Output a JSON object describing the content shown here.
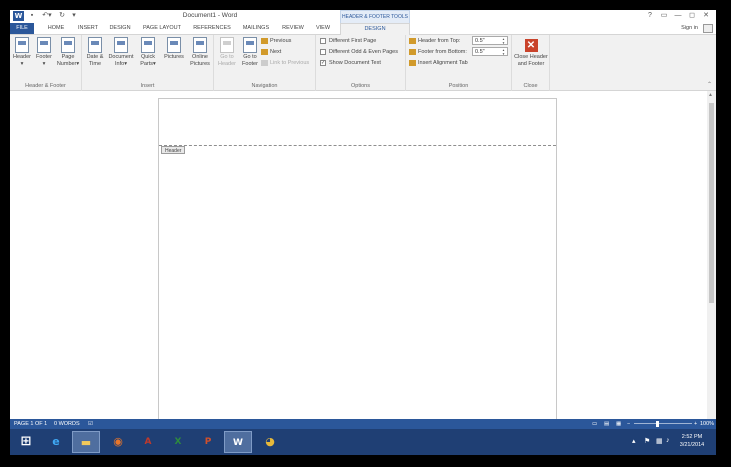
{
  "window": {
    "title": "Document1 - Word",
    "tools_header": "HEADER & FOOTER TOOLS",
    "controls": [
      "?",
      "▭",
      "—",
      "◻",
      "✕"
    ]
  },
  "tabs": {
    "file": "FILE",
    "items": [
      "HOME",
      "INSERT",
      "DESIGN",
      "PAGE LAYOUT",
      "REFERENCES",
      "MAILINGS",
      "REVIEW",
      "VIEW"
    ],
    "active": "DESIGN",
    "sign_in": "Sign in"
  },
  "ribbon": {
    "header_footer": {
      "label": "Header & Footer",
      "header": "Header",
      "footer": "Footer",
      "page_number_1": "Page",
      "page_number_2": "Number"
    },
    "insert": {
      "label": "Insert",
      "date_time_1": "Date &",
      "date_time_2": "Time",
      "doc_info_1": "Document",
      "doc_info_2": "Info",
      "quick_parts_1": "Quick",
      "quick_parts_2": "Parts",
      "pictures": "Pictures",
      "online_pictures_1": "Online",
      "online_pictures_2": "Pictures"
    },
    "navigation": {
      "label": "Navigation",
      "go_to_header_1": "Go to",
      "go_to_header_2": "Header",
      "go_to_footer_1": "Go to",
      "go_to_footer_2": "Footer",
      "previous": "Previous",
      "next": "Next",
      "link_to_previous": "Link to Previous"
    },
    "options": {
      "label": "Options",
      "different_first_page": "Different First Page",
      "different_odd_even": "Different Odd & Even Pages",
      "show_document_text": "Show Document Text",
      "show_document_text_checked": true
    },
    "position": {
      "label": "Position",
      "header_from_top": "Header from Top:",
      "header_from_top_value": "0.5\"",
      "footer_from_bottom": "Footer from Bottom:",
      "footer_from_bottom_value": "0.5\"",
      "insert_alignment_tab": "Insert Alignment Tab"
    },
    "close": {
      "label": "Close",
      "close_hf_1": "Close Header",
      "close_hf_2": "and Footer"
    }
  },
  "document": {
    "header_tag": "Header"
  },
  "statusbar": {
    "page": "PAGE 1 OF 1",
    "words": "0 WORDS",
    "zoom": "100%"
  },
  "taskbar": {
    "time": "2:52 PM",
    "date": "3/21/2014"
  },
  "colors": {
    "accent": "#2b579a",
    "taskbar": "#1f3f74"
  }
}
